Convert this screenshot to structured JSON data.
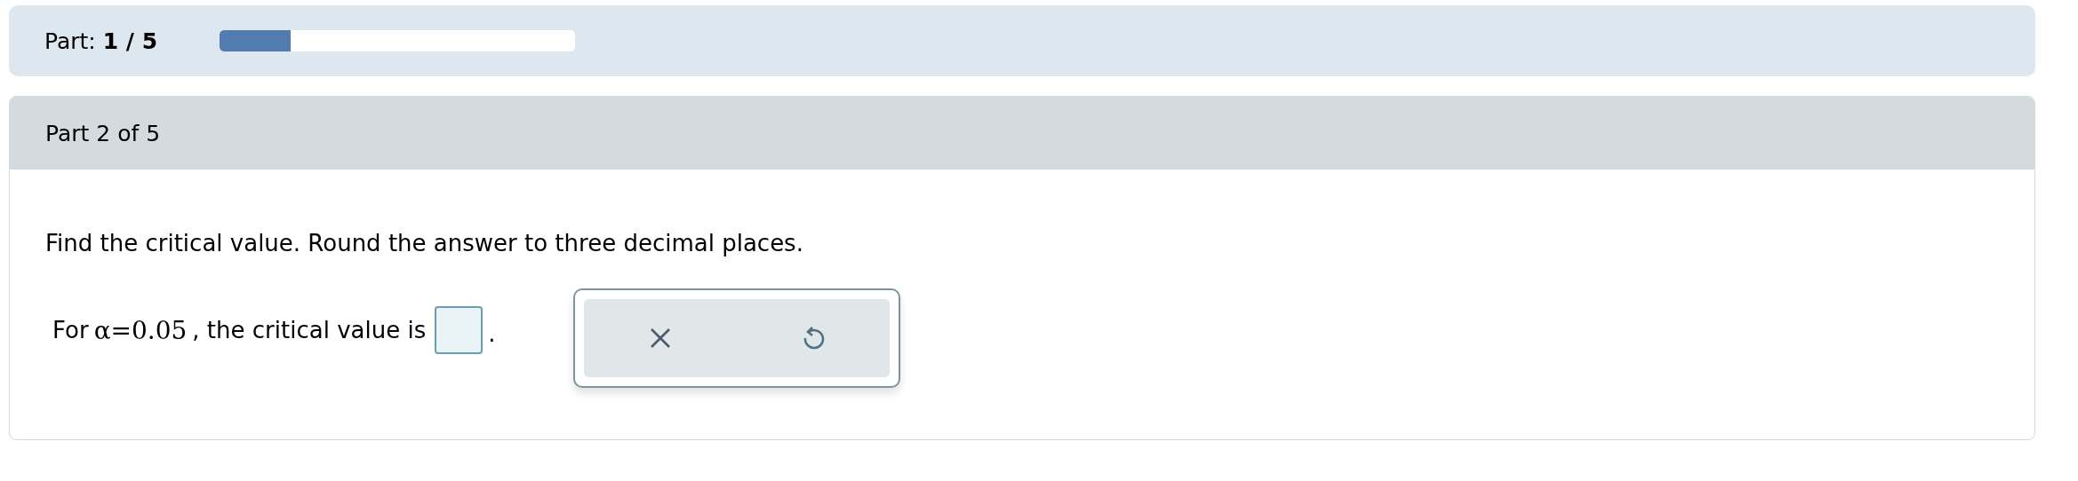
{
  "progress": {
    "label": "Part: **1 / 5**",
    "level": 0.2
  },
  "part_header": "Part 2 of 5",
  "question": "Find the critical value. Round the answer to three decimal places.",
  "prompt": {
    "before": "For",
    "math": "α=0.05",
    "after": ", the critical value is",
    "end": "."
  },
  "tools": [
    {
      "kind": "clear"
    },
    {
      "kind": "undo"
    }
  ]
}
